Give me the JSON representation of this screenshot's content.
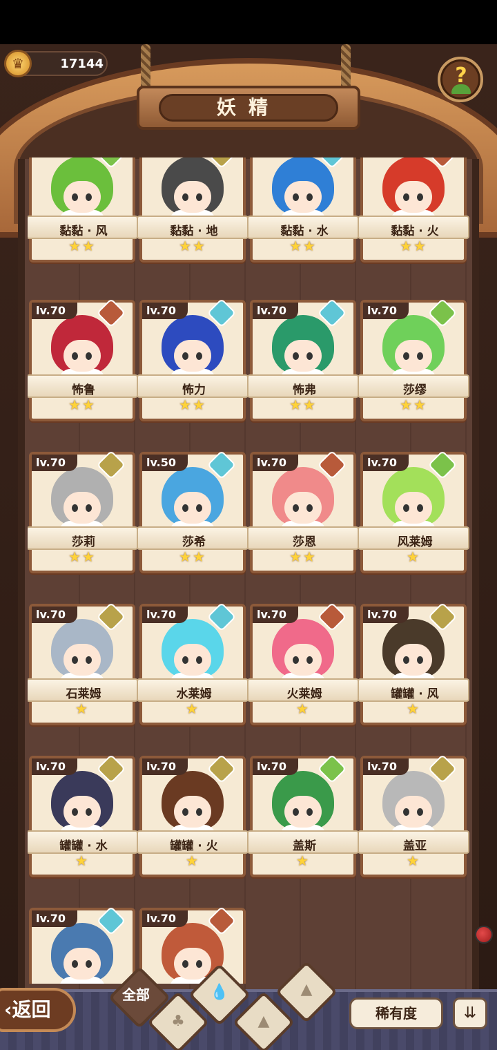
{
  "header": {
    "coins": "17144",
    "title": "妖精",
    "help_symbol": "?"
  },
  "colors": {
    "wind": "#7bc24a",
    "earth": "#b8a24a",
    "water": "#5fc6d6",
    "fire": "#b85a3a",
    "star": "#ffd338"
  },
  "cards": [
    {
      "name": "黏黏 · 风",
      "level": "",
      "stars": "★★",
      "hair": "#6bbf3c",
      "el": "wind"
    },
    {
      "name": "黏黏 · 地",
      "level": "",
      "stars": "★★",
      "hair": "#4a4a4a",
      "el": "earth"
    },
    {
      "name": "黏黏 · 水",
      "level": "",
      "stars": "★★",
      "hair": "#2f7fd6",
      "el": "water"
    },
    {
      "name": "黏黏 · 火",
      "level": "",
      "stars": "★★",
      "hair": "#d63b2a",
      "el": "fire"
    },
    {
      "name": "怖鲁",
      "level": "lv.70",
      "stars": "★★",
      "hair": "#c0283a",
      "el": "fire"
    },
    {
      "name": "怖力",
      "level": "lv.70",
      "stars": "★★",
      "hair": "#2d4bbf",
      "el": "water"
    },
    {
      "name": "怖弗",
      "level": "lv.70",
      "stars": "★★",
      "hair": "#2a9a6a",
      "el": "water"
    },
    {
      "name": "莎缪",
      "level": "lv.70",
      "stars": "★★",
      "hair": "#6fd05a",
      "el": "wind"
    },
    {
      "name": "莎莉",
      "level": "lv.70",
      "stars": "★★",
      "hair": "#b0b0b0",
      "el": "earth"
    },
    {
      "name": "莎希",
      "level": "lv.50",
      "stars": "★★",
      "hair": "#4aa6e0",
      "el": "water"
    },
    {
      "name": "莎恩",
      "level": "lv.70",
      "stars": "★★",
      "hair": "#f08a8a",
      "el": "fire"
    },
    {
      "name": "风莱姆",
      "level": "lv.70",
      "stars": "★",
      "hair": "#a3e05a",
      "el": "wind"
    },
    {
      "name": "石莱姆",
      "level": "lv.70",
      "stars": "★",
      "hair": "#a9b7c7",
      "el": "earth"
    },
    {
      "name": "水莱姆",
      "level": "lv.70",
      "stars": "★",
      "hair": "#5ad6ea",
      "el": "water"
    },
    {
      "name": "火莱姆",
      "level": "lv.70",
      "stars": "★",
      "hair": "#f06a8a",
      "el": "fire"
    },
    {
      "name": "罐罐 · 风",
      "level": "lv.70",
      "stars": "★",
      "hair": "#4a3a2a",
      "el": "earth"
    },
    {
      "name": "罐罐 · 水",
      "level": "lv.70",
      "stars": "★",
      "hair": "#3a3a5a",
      "el": "earth"
    },
    {
      "name": "罐罐 · 火",
      "level": "lv.70",
      "stars": "★",
      "hair": "#6a3a22",
      "el": "earth"
    },
    {
      "name": "盖斯",
      "level": "lv.70",
      "stars": "★",
      "hair": "#3a9a4a",
      "el": "wind"
    },
    {
      "name": "盖亚",
      "level": "lv.70",
      "stars": "★",
      "hair": "#b8b8b8",
      "el": "earth"
    },
    {
      "name": "",
      "level": "lv.70",
      "stars": "",
      "hair": "#4a7ab0",
      "el": "water"
    },
    {
      "name": "",
      "level": "lv.70",
      "stars": "",
      "hair": "#c05a3a",
      "el": "fire"
    }
  ],
  "bottom": {
    "back_label": "返回",
    "filter_all_label": "全部",
    "rarity_label": "稀有度",
    "sort_symbol": "⇊"
  }
}
